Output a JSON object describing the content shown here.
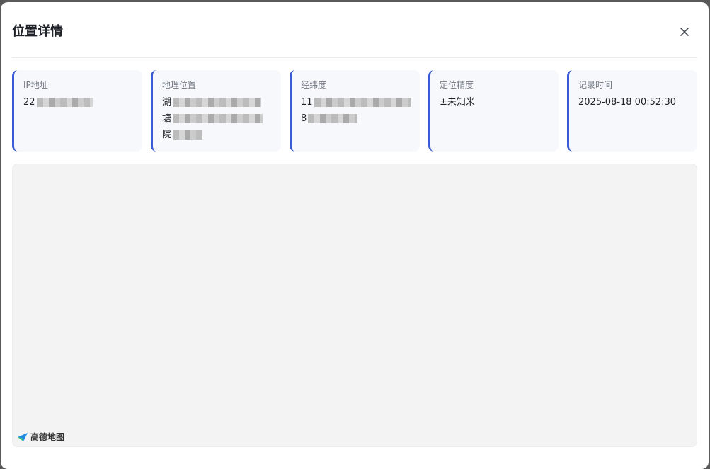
{
  "dialog": {
    "title": "位置详情",
    "close_icon": "close-icon"
  },
  "cards": {
    "ip": {
      "label": "IP地址",
      "value_lines": [
        "22"
      ]
    },
    "location": {
      "label": "地理位置",
      "value_lines": [
        "湖",
        "塘",
        "院"
      ]
    },
    "coordinates": {
      "label": "经纬度",
      "value_lines": [
        "11",
        "8"
      ]
    },
    "accuracy": {
      "label": "定位精度",
      "value": "±未知米"
    },
    "time": {
      "label": "记录时间",
      "value": "2025-08-18 00:52:30"
    }
  },
  "map": {
    "provider_logo": "高德地图",
    "logo_icon": "amap-logo-icon"
  },
  "colors": {
    "accent": "#3b5bd6",
    "card_bg": "#f6f8fb",
    "map_bg": "#f3f3f3"
  }
}
